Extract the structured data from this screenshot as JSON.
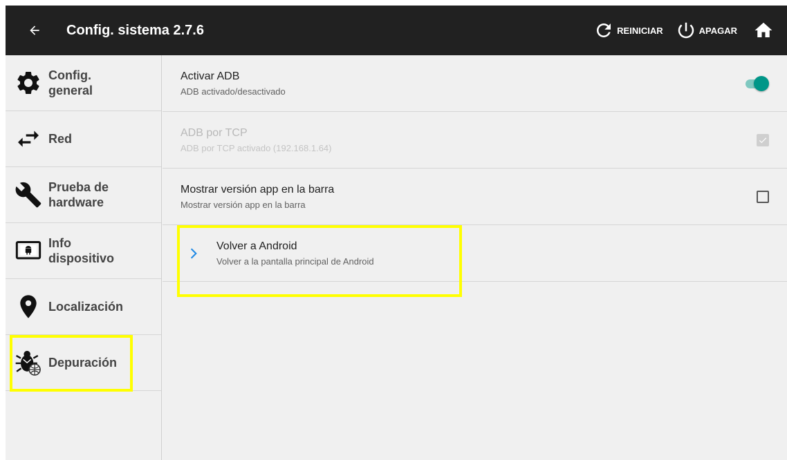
{
  "header": {
    "title": "Config. sistema 2.7.6",
    "restart_label": "REINICIAR",
    "shutdown_label": "APAGAR"
  },
  "sidebar": {
    "items": [
      {
        "label": "Config. general",
        "icon": "gear-icon"
      },
      {
        "label": "Red",
        "icon": "swap-arrows-icon"
      },
      {
        "label": "Prueba de hardware",
        "icon": "wrench-icon"
      },
      {
        "label": "Info dispositivo",
        "icon": "tablet-android-icon"
      },
      {
        "label": "Localización",
        "icon": "location-pin-icon"
      },
      {
        "label": "Depuración",
        "icon": "bug-icon"
      }
    ],
    "selected": "Depuración"
  },
  "settings": [
    {
      "title": "Activar ADB",
      "subtitle": "ADB activado/desactivado",
      "control": "toggle",
      "on": true,
      "enabled": true
    },
    {
      "title": "ADB por TCP",
      "subtitle": "ADB por TCP activado (192.168.1.64)",
      "control": "checkbox",
      "checked": true,
      "enabled": false
    },
    {
      "title": "Mostrar versión app en la barra",
      "subtitle": "Mostrar versión app en la barra",
      "control": "checkbox",
      "checked": false,
      "enabled": true
    },
    {
      "title": "Volver a Android",
      "subtitle": "Volver a la pantalla principal de Android",
      "control": "chevron",
      "enabled": true
    }
  ],
  "colors": {
    "topbar": "#212121",
    "accent": "#009688",
    "chevron": "#1e88e5",
    "highlight": "#ffff00"
  }
}
